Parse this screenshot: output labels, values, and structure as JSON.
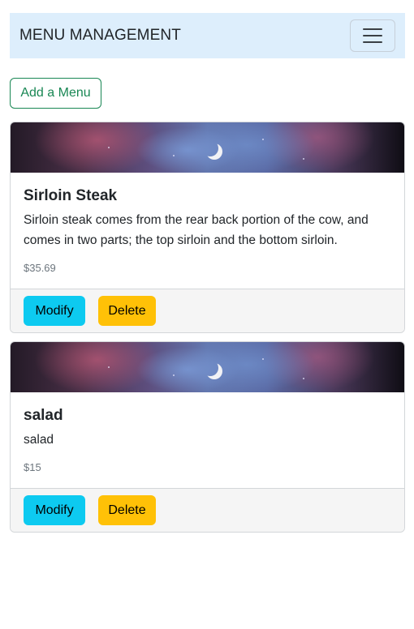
{
  "navbar": {
    "brand": "MENU MANAGEMENT",
    "toggle_icon": "hamburger-menu-icon"
  },
  "actions": {
    "add_label": "Add a Menu"
  },
  "menus": [
    {
      "title": "Sirloin Steak",
      "description": "Sirloin steak comes from the rear back portion of the cow, and comes in two parts; the top sirloin and the bottom sirloin.",
      "price": "$35.69",
      "modify_label": "Modify",
      "delete_label": "Delete"
    },
    {
      "title": "salad",
      "description": "salad",
      "price": "$15",
      "modify_label": "Modify",
      "delete_label": "Delete"
    }
  ],
  "colors": {
    "navbar_bg": "#ddeefc",
    "add_outline": "#198754",
    "modify_bg": "#0dcaf0",
    "delete_bg": "#ffc107"
  }
}
